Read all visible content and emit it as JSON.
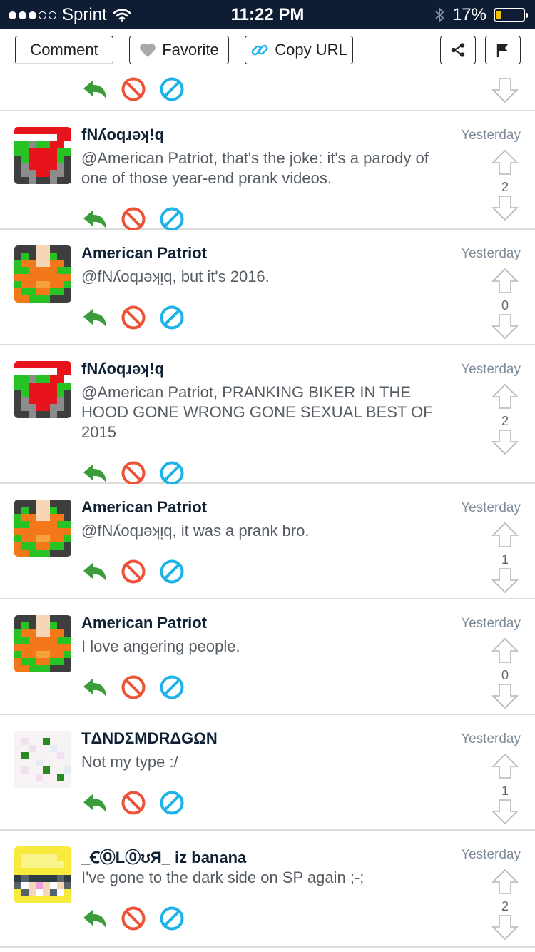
{
  "status_bar": {
    "carrier": "Sprint",
    "time": "11:22 PM",
    "battery_percent": "17%",
    "battery_level": 0.17,
    "signal_filled": 3,
    "signal_total": 5
  },
  "toolbar": {
    "comment_label": "Comment",
    "favorite_label": "Favorite",
    "copy_url_label": "Copy URL"
  },
  "colors": {
    "reply": "#3c9c3c",
    "block": "#ee5236",
    "ban": "#1cb3ea",
    "navy": "#0e1d33"
  },
  "comments": [
    {
      "username": "fNʎoqɹǝʞ!q",
      "time": "Yesterday",
      "text": "@American Patriot, that's the joke: it's a parody of one of those year-end prank videos.",
      "votes": "2",
      "avatar": "santa"
    },
    {
      "username": "American Patriot",
      "time": "Yesterday",
      "text": "@fNʎoqɹǝʞᴉq, but it's 2016.",
      "votes": "0",
      "avatar": "patriot"
    },
    {
      "username": "fNʎoqɹǝʞ!q",
      "time": "Yesterday",
      "text": "@American Patriot, PRANKING BIKER IN THE HOOD GONE WRONG GONE SEXUAL BEST OF 2015",
      "votes": "2",
      "avatar": "santa"
    },
    {
      "username": "American Patriot",
      "time": "Yesterday",
      "text": "@fNʎoqɹǝʞᴉq, it was a prank bro.",
      "votes": "1",
      "avatar": "patriot"
    },
    {
      "username": "American Patriot",
      "time": "Yesterday",
      "text": "I love angering people.",
      "votes": "0",
      "avatar": "patriot"
    },
    {
      "username": "TΔNDΣMDRΔGΩN",
      "time": "Yesterday",
      "text": "Not my type :/",
      "votes": "1",
      "avatar": "faded"
    },
    {
      "username": "_ꞒⓄL⓪ʊЯ_ iz banana",
      "time": "Yesterday",
      "text": "I've gone to the dark side on SP again ;-;",
      "votes": "2",
      "avatar": "banana"
    }
  ]
}
